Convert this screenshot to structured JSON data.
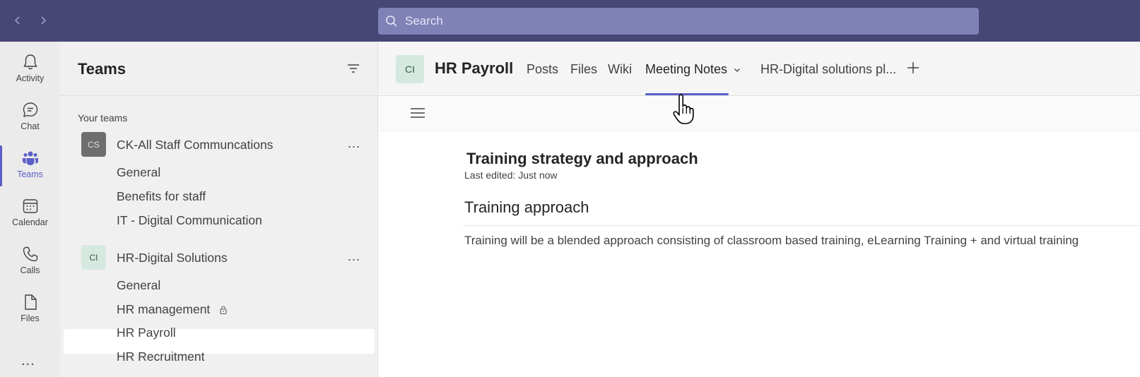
{
  "topbar": {
    "back_icon": "chevron-left-icon",
    "forward_icon": "chevron-right-icon",
    "search_placeholder": "Search",
    "bg_color": "#464775",
    "search_color": "#8081b6"
  },
  "rail": {
    "items": [
      {
        "label": "Activity",
        "icon": "bell-icon"
      },
      {
        "label": "Chat",
        "icon": "chat-icon"
      },
      {
        "label": "Teams",
        "icon": "teams-icon",
        "active": true
      },
      {
        "label": "Calendar",
        "icon": "calendar-icon"
      },
      {
        "label": "Calls",
        "icon": "phone-icon"
      },
      {
        "label": "Files",
        "icon": "file-icon"
      }
    ],
    "more_label": "..."
  },
  "panel": {
    "title": "Teams",
    "section_label": "Your teams",
    "teams": [
      {
        "avatar": "CS",
        "name": "CK-All Staff Communcations",
        "channels": [
          "General",
          "Benefits for staff",
          "IT - Digital Communication"
        ]
      },
      {
        "avatar": "CI",
        "name": "HR-Digital Solutions",
        "channels": [
          "General",
          "HR management",
          "HR Payroll",
          "HR Recruitment"
        ]
      }
    ],
    "more_label": "..."
  },
  "channel_header": {
    "avatar": "CI",
    "title": "HR Payroll",
    "tabs": [
      "Posts",
      "Files",
      "Wiki",
      "Meeting Notes",
      "HR-Digital solutions pl..."
    ],
    "active_tab": "Meeting Notes",
    "accent_color": "#5b5fc7"
  },
  "document": {
    "title": "Training strategy and approach",
    "last_edited": "Last edited: Just now",
    "heading": "Training approach",
    "paragraph": "Training will be a blended approach consisting of classroom based training, eLearning Training + and virtual training"
  }
}
